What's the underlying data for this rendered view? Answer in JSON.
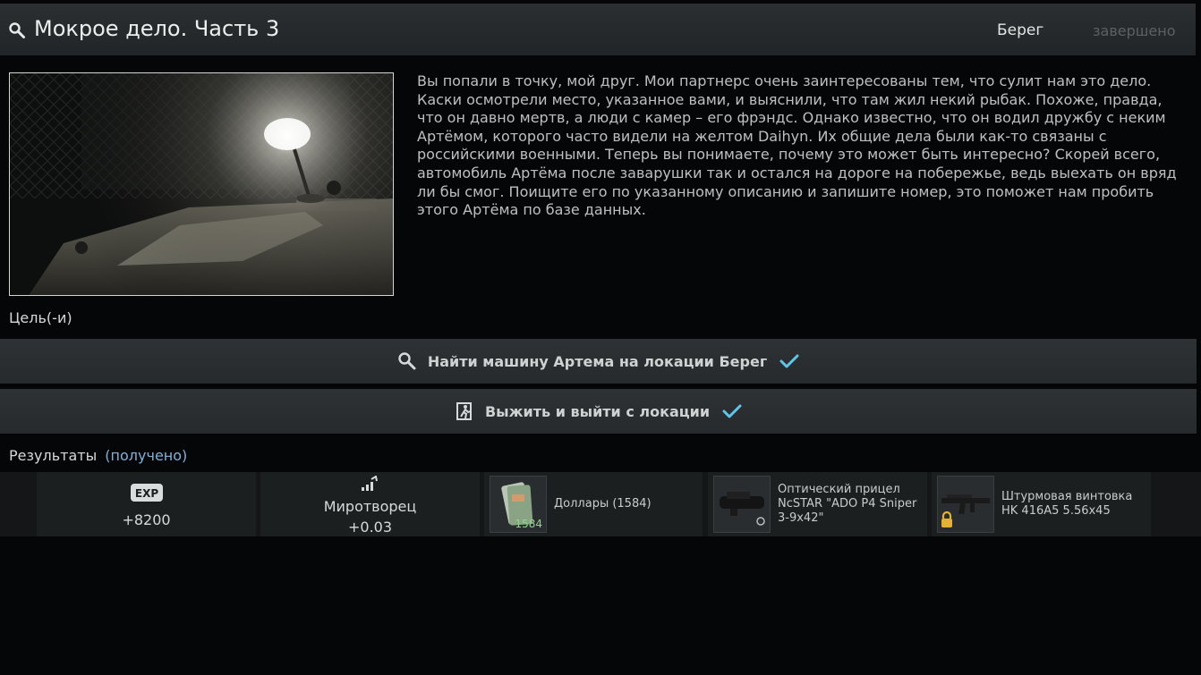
{
  "header": {
    "title": "Мокрое дело. Часть 3",
    "location": "Берег",
    "status": "завершено"
  },
  "description": "Вы попали в точку, мой друг. Мои партнерс очень заинтересованы тем, что сулит нам это дело. Каски осмотрели место, указанное вами, и выяснили, что там жил некий рыбак. Похоже, правда, что он давно мертв, а люди с камер – его фрэндс. Однако известно, что он водил дружбу с неким Артёмом, которого часто видели на желтом Daihyn. Их общие дела были как-то связаны с российскими военными. Теперь вы понимаете, почему это может быть интересно? Скорей всего, автомобиль Артёма после заварушки так и остался на дороге на побережье, ведь выехать он вряд ли бы смог. Поищите его по указанному описанию и запишите номер, это поможет нам пробить этого Артёма по базе данных.",
  "objectives_label": "Цель(-и)",
  "objectives": [
    {
      "text": "Найти машину Артема на локации Берег",
      "icon": "search-icon"
    },
    {
      "text": "Выжить и выйти с локации",
      "icon": "exit-run-icon"
    }
  ],
  "results": {
    "label": "Результаты",
    "received": "(получено)"
  },
  "rewards": {
    "exp": {
      "icon": "exp-badge-icon",
      "value": "+8200"
    },
    "standing": {
      "trader": "Миротворец",
      "value": "+0.03"
    },
    "items": [
      {
        "name": "Доллары (1584)",
        "count": "1584"
      },
      {
        "name": "Оптический прицел NcSTAR \"ADO P4 Sniper 3-9x42\""
      },
      {
        "name": "Штурмовая винтовка HK 416A5 5.56x45"
      }
    ]
  },
  "colors": {
    "accent_check": "#5fc6ea",
    "received": "#7fb2d9",
    "status_muted": "#5d6062"
  }
}
